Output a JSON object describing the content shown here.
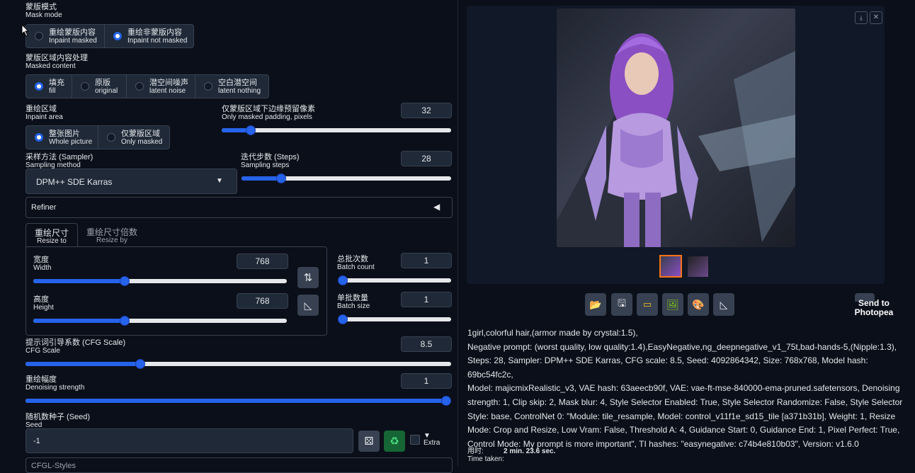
{
  "mask_mode": {
    "label_zh": "蒙版模式",
    "label_en": "Mask mode",
    "options": [
      {
        "zh": "重绘蒙版内容",
        "en": "Inpaint masked",
        "selected": false
      },
      {
        "zh": "重绘非蒙版内容",
        "en": "Inpaint not masked",
        "selected": true
      }
    ]
  },
  "masked_content": {
    "label_zh": "蒙版区域内容处理",
    "label_en": "Masked content",
    "options": [
      {
        "zh": "填充",
        "en": "fill",
        "selected": true
      },
      {
        "zh": "原版",
        "en": "original",
        "selected": false
      },
      {
        "zh": "潜空间噪声",
        "en": "latent noise",
        "selected": false
      },
      {
        "zh": "空白潜空间",
        "en": "latent nothing",
        "selected": false
      }
    ]
  },
  "inpaint_area": {
    "label_zh": "重绘区域",
    "label_en": "Inpaint area",
    "options": [
      {
        "zh": "整张图片",
        "en": "Whole picture",
        "selected": true
      },
      {
        "zh": "仅蒙版区域",
        "en": "Only masked",
        "selected": false
      }
    ]
  },
  "padding": {
    "label_zh": "仅蒙版区域下边缘预留像素",
    "label_en": "Only masked padding, pixels",
    "value": "32",
    "fraction": 0.125
  },
  "sampler": {
    "label_zh": "采样方法 (Sampler)",
    "label_en": "Sampling method",
    "value": "DPM++ SDE Karras"
  },
  "steps": {
    "label_zh": "迭代步数 (Steps)",
    "label_en": "Sampling steps",
    "value": "28",
    "fraction": 0.19
  },
  "refiner": {
    "label": "Refiner"
  },
  "resize_tabs": [
    {
      "zh": "重绘尺寸",
      "en": "Resize to",
      "active": true
    },
    {
      "zh": "重绘尺寸倍数",
      "en": "Resize by",
      "active": false
    }
  ],
  "width": {
    "label_zh": "宽度",
    "label_en": "Width",
    "value": "768",
    "fraction": 0.36
  },
  "height": {
    "label_zh": "高度",
    "label_en": "Height",
    "value": "768",
    "fraction": 0.36
  },
  "batch_count": {
    "label_zh": "总批次数",
    "label_en": "Batch count",
    "value": "1",
    "fraction": 0.0
  },
  "batch_size": {
    "label_zh": "单批数量",
    "label_en": "Batch size",
    "value": "1",
    "fraction": 0.0
  },
  "cfg": {
    "label_zh": "提示词引导系数 (CFG Scale)",
    "label_en": "CFG Scale",
    "value": "8.5",
    "fraction": 0.27
  },
  "denoise": {
    "label_zh": "重绘幅度",
    "label_en": "Denoising strength",
    "value": "1",
    "fraction": 1.0
  },
  "seed": {
    "label_zh": "随机数种子 (Seed)",
    "label_en": "Seed",
    "value": "-1",
    "extra_label": "Extra"
  },
  "cutoff_label": "CFGL-Styles",
  "right": {
    "send_to_photopea": "Send to Photopea",
    "gen_info": [
      "1girl,colorful hair,(armor made by crystal:1.5),",
      "Negative prompt: (worst quality, low quality:1.4),EasyNegative,ng_deepnegative_v1_75t,bad-hands-5,(Nipple:1.3),",
      "Steps: 28, Sampler: DPM++ SDE Karras, CFG scale: 8.5, Seed: 4092864342, Size: 768x768, Model hash: 69bc54fc2c,",
      "Model: majicmixRealistic_v3, VAE hash: 63aeecb90f, VAE: vae-ft-mse-840000-ema-pruned.safetensors, Denoising",
      "strength: 1, Clip skip: 2, Mask blur: 4, Style Selector Enabled: True, Style Selector Randomize: False, Style Selector",
      "Style: base, ControlNet 0: \"Module: tile_resample, Model: control_v11f1e_sd15_tile [a371b31b], Weight: 1, Resize",
      "Mode: Crop and Resize, Low Vram: False, Threshold A: 4, Guidance Start: 0, Guidance End: 1, Pixel Perfect: True,",
      "Control Mode: My prompt is more important\", TI hashes: \"easynegative: c74b4e810b03\", Version: v1.6.0"
    ],
    "time_label_zh": "用时:",
    "time_label_en": "Time taken:",
    "time_value": "2 min. 23.6 sec."
  },
  "colors": {
    "accent": "#2563eb",
    "panel": "#1f2937",
    "bg": "#0b0f19",
    "border": "#374151"
  }
}
